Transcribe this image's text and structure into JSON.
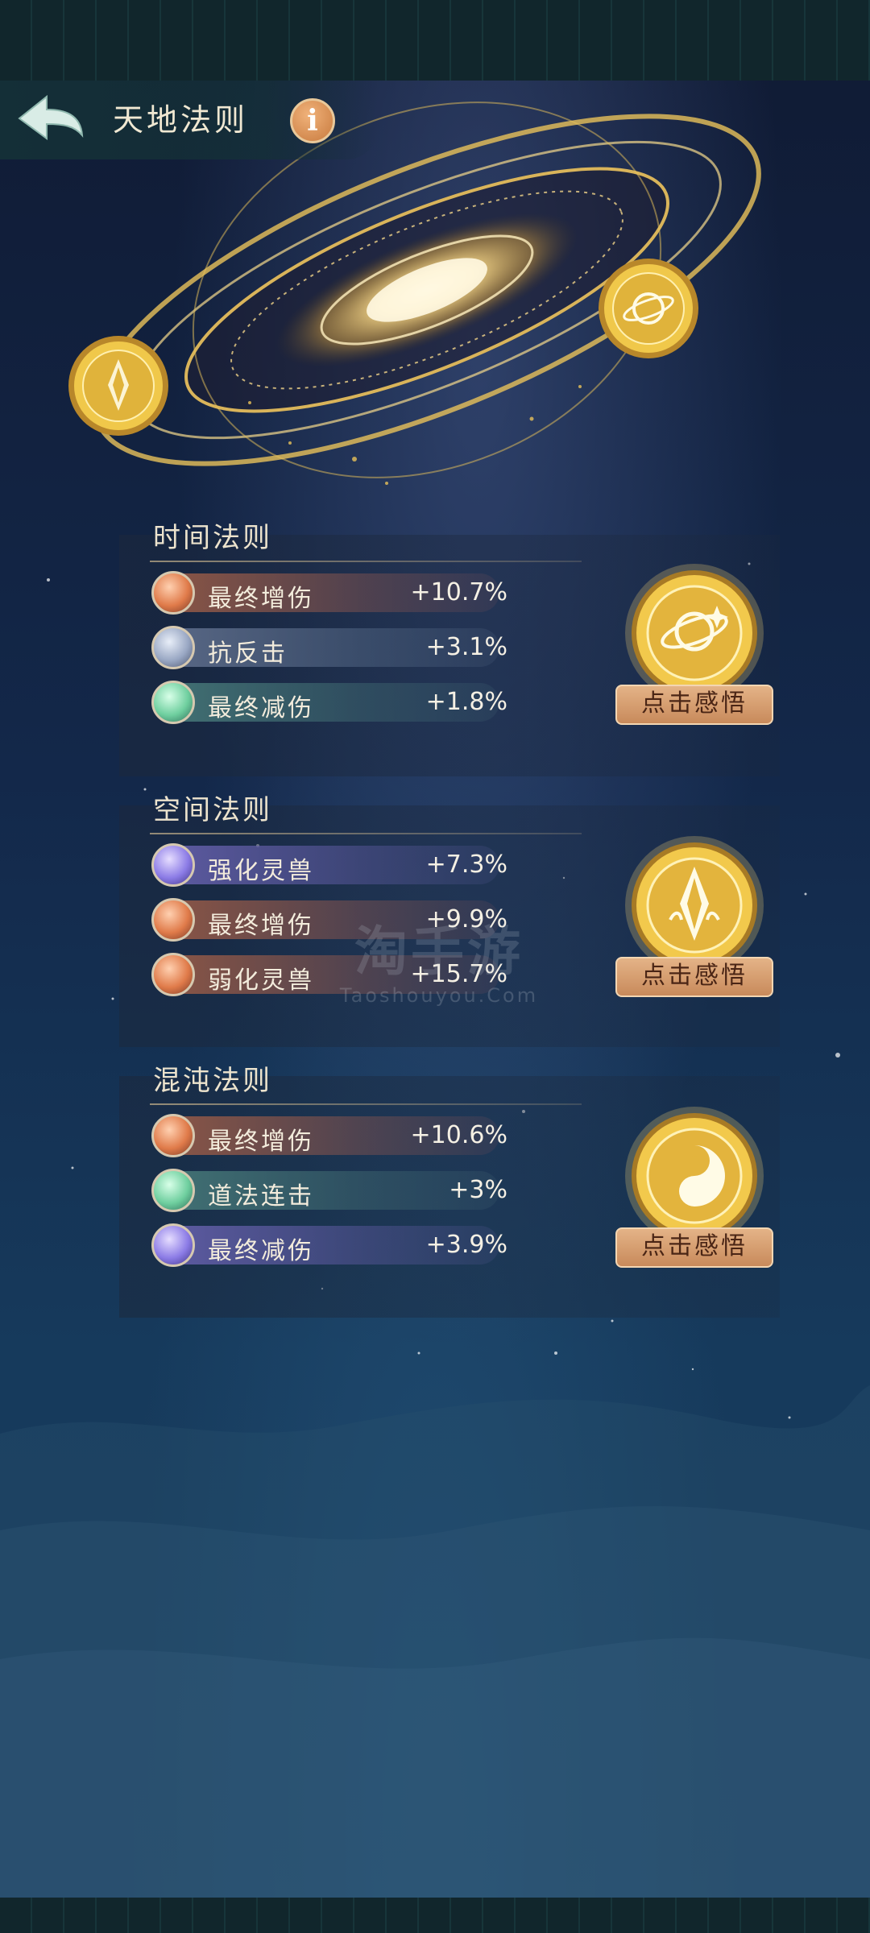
{
  "header": {
    "title": "天地法则",
    "info_label": "i"
  },
  "sections": [
    {
      "title": "时间法则",
      "stats": [
        {
          "name": "最终增伤",
          "value": "+10.7%",
          "orb": "orange"
        },
        {
          "name": "抗反击",
          "value": "+3.1%",
          "orb": "blue"
        },
        {
          "name": "最终减伤",
          "value": "+1.8%",
          "orb": "green"
        }
      ],
      "emblem": "planet-emblem-icon",
      "button": "点击感悟"
    },
    {
      "title": "空间法则",
      "stats": [
        {
          "name": "强化灵兽",
          "value": "+7.3%",
          "orb": "purple"
        },
        {
          "name": "最终增伤",
          "value": "+9.9%",
          "orb": "orange"
        },
        {
          "name": "弱化灵兽",
          "value": "+15.7%",
          "orb": "orange"
        }
      ],
      "emblem": "crystal-emblem-icon",
      "button": "点击感悟"
    },
    {
      "title": "混沌法则",
      "stats": [
        {
          "name": "最终增伤",
          "value": "+10.6%",
          "orb": "orange"
        },
        {
          "name": "道法连击",
          "value": "+3%",
          "orb": "green"
        },
        {
          "name": "最终减伤",
          "value": "+3.9%",
          "orb": "purple"
        }
      ],
      "emblem": "yin-yang-emblem-icon",
      "button": "点击感悟"
    }
  ],
  "watermark": {
    "main": "淘手游",
    "sub": "Taoshouyou.Com"
  },
  "colors": {
    "gold": "#e8c25a",
    "button_bg": "#d9a274",
    "text_light": "#f3ecdc"
  }
}
